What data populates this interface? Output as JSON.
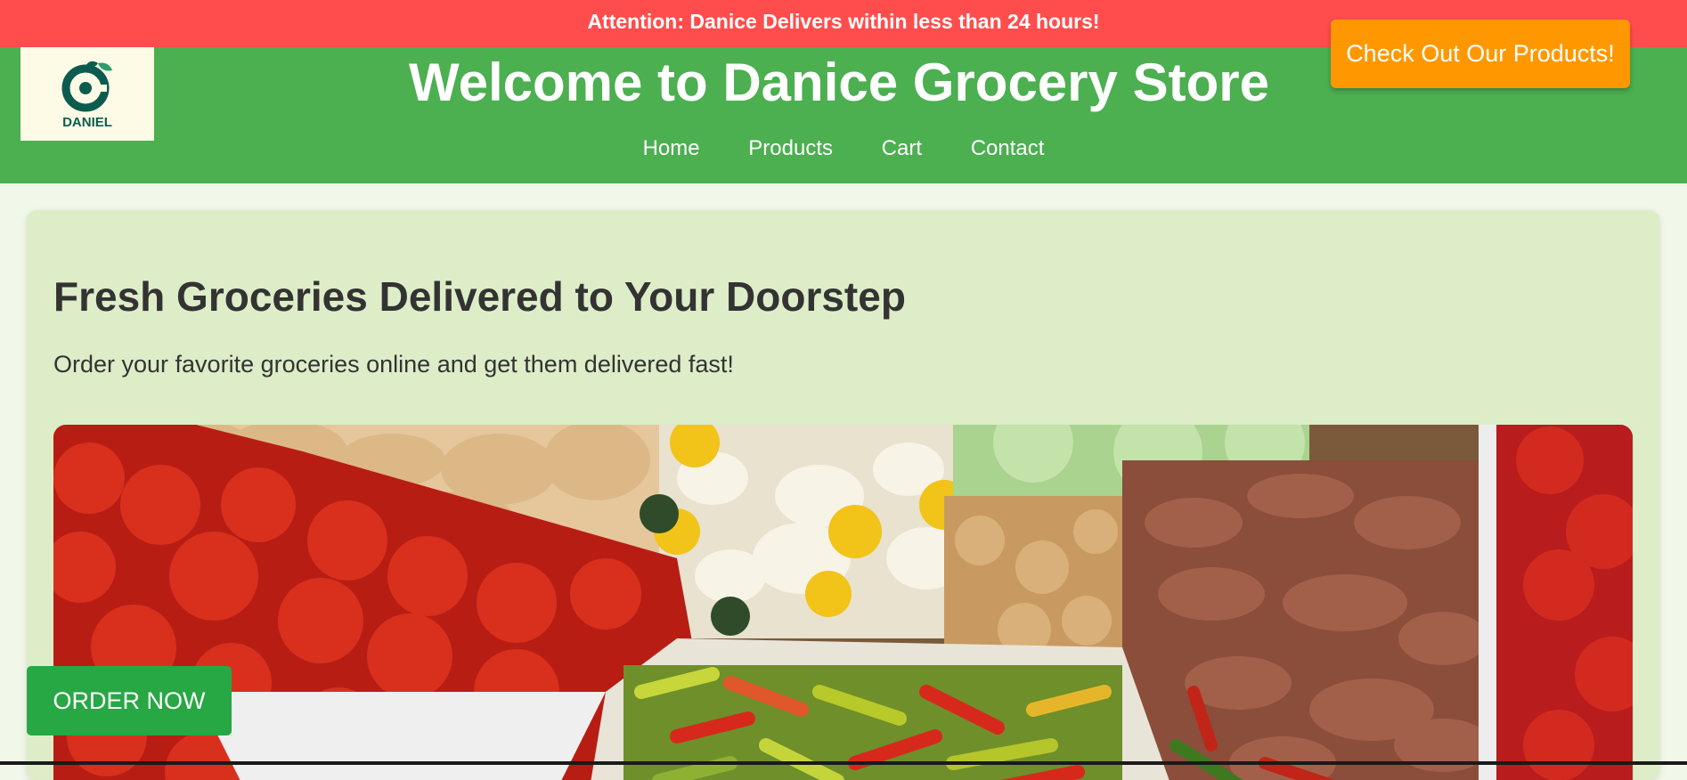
{
  "announcement": {
    "label": "Attention:",
    "text": " Danice Delivers within less than 24 hours!"
  },
  "header": {
    "logo_text": "DANIEL",
    "title": "Welcome to Danice Grocery Store",
    "nav": [
      "Home",
      "Products",
      "Cart",
      "Contact"
    ],
    "cta": "Check Out Our Products!"
  },
  "hero": {
    "heading": "Fresh Groceries Delivered to Your Doorstep",
    "subtext": "Order your favorite groceries online and get them delivered fast!"
  },
  "order_button": "ORDER NOW",
  "colors": {
    "banner": "#ff4d4d",
    "header": "#4caf50",
    "cta": "#ff9800",
    "order": "#28a745",
    "hero_bg": "#ddedc8"
  }
}
